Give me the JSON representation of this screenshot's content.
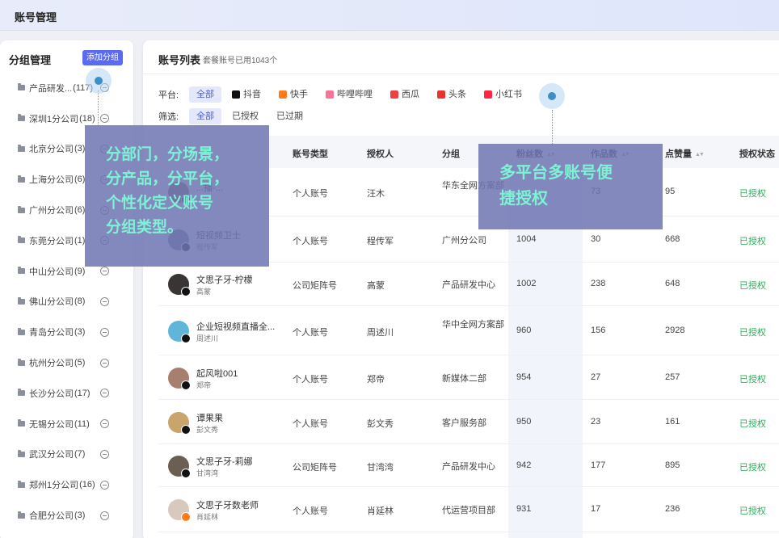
{
  "topbar": {
    "title": "账号管理"
  },
  "sidebar": {
    "title": "分组管理",
    "add_button": "添加分组",
    "groups": [
      {
        "label": "产品研发...",
        "count": "(117)"
      },
      {
        "label": "深圳1分公司",
        "count": "(18)"
      },
      {
        "label": "北京分公司",
        "count": "(3)"
      },
      {
        "label": "上海分公司",
        "count": "(6)"
      },
      {
        "label": "广州分公司",
        "count": "(6)"
      },
      {
        "label": "东莞分公司",
        "count": "(1)"
      },
      {
        "label": "中山分公司",
        "count": "(9)"
      },
      {
        "label": "佛山分公司",
        "count": "(8)"
      },
      {
        "label": "青岛分公司",
        "count": "(3)"
      },
      {
        "label": "杭州分公司",
        "count": "(5)"
      },
      {
        "label": "长沙分公司",
        "count": "(17)"
      },
      {
        "label": "无锡分公司",
        "count": "(11)"
      },
      {
        "label": "武汉分公司",
        "count": "(7)"
      },
      {
        "label": "郑州1分公司",
        "count": "(16)"
      },
      {
        "label": "合肥分公司",
        "count": "(3)"
      }
    ]
  },
  "main": {
    "title": "账号列表",
    "subtitle": "套餐账号已用1043个",
    "platform_label": "平台:",
    "platforms": [
      {
        "label": "全部",
        "active": true,
        "icon": "",
        "color": ""
      },
      {
        "label": "抖音",
        "active": false,
        "icon": "douyin-icon",
        "color": "#111111"
      },
      {
        "label": "快手",
        "active": false,
        "icon": "kuaishou-icon",
        "color": "#ff7a1a"
      },
      {
        "label": "哔哩哔哩",
        "active": false,
        "icon": "bilibili-icon",
        "color": "#fb7299"
      },
      {
        "label": "西瓜",
        "active": false,
        "icon": "xigua-icon",
        "color": "#f04142"
      },
      {
        "label": "头条",
        "active": false,
        "icon": "toutiao-icon",
        "color": "#e8332e"
      },
      {
        "label": "小红书",
        "active": false,
        "icon": "xiaohongshu-icon",
        "color": "#ff2442"
      }
    ],
    "filter_label": "筛选:",
    "filters": [
      {
        "label": "全部",
        "active": true
      },
      {
        "label": "已授权",
        "active": false
      },
      {
        "label": "已过期",
        "active": false
      }
    ],
    "columns": [
      "账号类型",
      "授权人",
      "分组",
      "粉丝数",
      "作品数",
      "点赞量",
      "授权状态"
    ],
    "rows": [
      {
        "name": "...播-...",
        "owner": "...",
        "type": "个人账号",
        "authorizer": "汪木",
        "group": "华东全网方案部",
        "fans": "",
        "works": "73",
        "likes": "95",
        "status": "已授权",
        "avatar_color": "#8a6b5a",
        "badge": "douyin"
      },
      {
        "name": "短视频卫士",
        "owner": "程传军",
        "type": "个人账号",
        "authorizer": "程传军",
        "group": "广州分公司",
        "fans": "1004",
        "works": "30",
        "likes": "668",
        "status": "已授权",
        "avatar_color": "#6b7f95",
        "badge": "douyin"
      },
      {
        "name": "文思子牙-柠檬",
        "owner": "高蒙",
        "type": "公司矩阵号",
        "authorizer": "高蒙",
        "group": "产品研发中心",
        "fans": "1002",
        "works": "238",
        "likes": "648",
        "status": "已授权",
        "avatar_color": "#3a3535",
        "badge": "douyin"
      },
      {
        "name": "企业短视频直播全...",
        "owner": "周述川",
        "type": "个人账号",
        "authorizer": "周述川",
        "group": "华中全网方案部",
        "fans": "960",
        "works": "156",
        "likes": "2928",
        "status": "已授权",
        "avatar_color": "#5fb6d8",
        "badge": "douyin"
      },
      {
        "name": "起风啦001",
        "owner": "郑帝",
        "type": "个人账号",
        "authorizer": "郑帝",
        "group": "新媒体二部",
        "fans": "954",
        "works": "27",
        "likes": "257",
        "status": "已授权",
        "avatar_color": "#a67f6f",
        "badge": "douyin"
      },
      {
        "name": "谭果果",
        "owner": "彭文秀",
        "type": "个人账号",
        "authorizer": "彭文秀",
        "group": "客户服务部",
        "fans": "950",
        "works": "23",
        "likes": "161",
        "status": "已授权",
        "avatar_color": "#c9a46b",
        "badge": "douyin"
      },
      {
        "name": "文思子牙-莉娜",
        "owner": "甘湾湾",
        "type": "公司矩阵号",
        "authorizer": "甘湾湾",
        "group": "产品研发中心",
        "fans": "942",
        "works": "177",
        "likes": "895",
        "status": "已授权",
        "avatar_color": "#6a5f52",
        "badge": "douyin"
      },
      {
        "name": "文思子牙数老师",
        "owner": "肖延林",
        "type": "个人账号",
        "authorizer": "肖延林",
        "group": "代运营项目部",
        "fans": "931",
        "works": "17",
        "likes": "236",
        "status": "已授权",
        "avatar_color": "#d9c8bd",
        "badge": "kuaishou"
      }
    ]
  },
  "callouts": {
    "left": [
      "分部门，分场景，",
      "分产品，分平台，",
      "个性化定义账号",
      "分组类型。"
    ],
    "right": [
      "多平台多账号便",
      "捷授权"
    ]
  }
}
